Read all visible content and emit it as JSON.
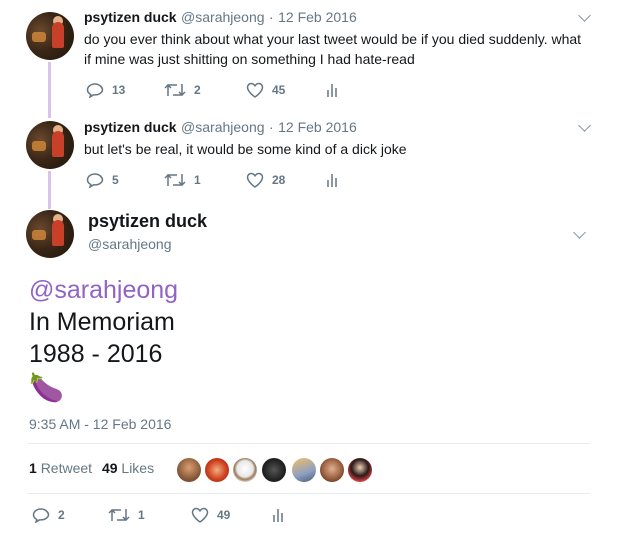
{
  "tweets": [
    {
      "name": "psytizen duck",
      "handle": "@sarahjeong",
      "sep": "·",
      "date": "12 Feb 2016",
      "text_line1": "do you ever think about what your last tweet would be if you died suddenly. what",
      "text_line2": "if mine was just shitting on something I had hate-read",
      "replies": "13",
      "retweets": "2",
      "likes": "45"
    },
    {
      "name": "psytizen duck",
      "handle": "@sarahjeong",
      "sep": "·",
      "date": "12 Feb 2016",
      "text_line1": "but let's be real, it would be some kind of a dick joke",
      "replies": "5",
      "retweets": "1",
      "likes": "28"
    }
  ],
  "main_tweet": {
    "name": "psytizen duck",
    "handle": "@sarahjeong",
    "mention": "@sarahjeong",
    "line2": "In Memoriam",
    "line3": "1988 - 2016",
    "emoji": "🍆",
    "timestamp": "9:35 AM - 12 Feb 2016",
    "retweet_count": "1",
    "retweet_label": "Retweet",
    "like_count": "49",
    "like_label": "Likes",
    "replies": "2",
    "retweets": "1",
    "likes": "49"
  },
  "colors": {
    "mention": "#9063c4",
    "thread_line": "#d8c4e6",
    "meta_gray": "#657786"
  },
  "icons": [
    "reply-icon",
    "retweet-icon",
    "like-icon",
    "analytics-icon",
    "chevron-down-icon"
  ]
}
